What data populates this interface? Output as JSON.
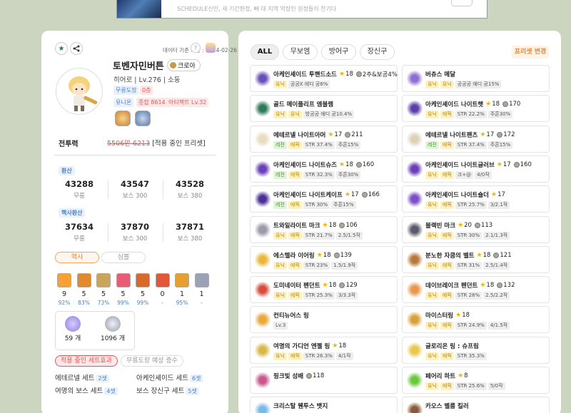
{
  "banner": {
    "text": "SCHEDULE신인, 새 기간한정, 빠 대 지역 악장인 원정들이 찬기다"
  },
  "profile": {
    "updated": "데이터 기준 시간 : 2024-02-26",
    "name": "토벤자민버튼",
    "world": "크로아",
    "job": "히어로 | Lv.276 | 소둥",
    "tags": {
      "murung": "무릉도장",
      "murung_floor": "0층",
      "union": "유니온",
      "union_val": "종합 8614",
      "artifact": "아티팩트 Lv.32"
    },
    "power_label": "전투력",
    "power_old": "5506만 6213",
    "power_note": "[적용 중인 프리셋]"
  },
  "stats": {
    "label1": "환산",
    "row1": [
      {
        "v": "43288",
        "l": "무릉"
      },
      {
        "v": "43547",
        "l": "보스 300"
      },
      {
        "v": "43528",
        "l": "보스 380"
      }
    ],
    "label2": "핵사환산",
    "row2": [
      {
        "v": "37634",
        "l": "무릉"
      },
      {
        "v": "37870",
        "l": "보스 300"
      },
      {
        "v": "37871",
        "l": "보스 380"
      }
    ]
  },
  "toggle": {
    "hexa": "핵사",
    "symbol": "심볼"
  },
  "symbols": [
    {
      "lv": "9",
      "pc": "92%",
      "c": "#f7a034"
    },
    {
      "lv": "5",
      "pc": "83%",
      "c": "#e0892d"
    },
    {
      "lv": "5",
      "pc": "73%",
      "c": "#c9a45a"
    },
    {
      "lv": "5",
      "pc": "99%",
      "c": "#e85d75"
    },
    {
      "lv": "5",
      "pc": "99%",
      "c": "#d86a2c"
    },
    {
      "lv": "0",
      "pc": "-",
      "c": "#e2573a"
    },
    {
      "lv": "1",
      "pc": "95%",
      "c": "#e5a030"
    },
    {
      "lv": "1",
      "pc": "-",
      "c": "#9aa3b5"
    }
  ],
  "symbol_totals": [
    {
      "t": "59 개",
      "c": "#8f7ee0"
    },
    {
      "t": "1096 개",
      "c": "#b7b9b0"
    }
  ],
  "sets": {
    "active_btn": "적용 중인 세트효과",
    "expected_btn": "무릉도장 예상 증수",
    "items": [
      {
        "name": "에테르넬 세트",
        "cnt": "2셋"
      },
      {
        "name": "아케인셰이드 세트",
        "cnt": "6셋"
      },
      {
        "name": "여명의 보스 세트",
        "cnt": "4셋"
      },
      {
        "name": "보스 장신구 세트",
        "cnt": "5셋"
      }
    ]
  },
  "tabs": [
    "ALL",
    "무보엠",
    "방어구",
    "장신구"
  ],
  "preset_btn": "프리셋 변경",
  "items": [
    {
      "name": "아케인셰이드 투핸드소드",
      "star": "18",
      "bl": "2추&보공4%",
      "tags": [
        [
          "유닉",
          "u"
        ],
        [
          "공공X 에디 공6%",
          "o"
        ]
      ],
      "c": "#6a4fb8"
    },
    {
      "name": "버츄스 메달",
      "star": "",
      "bl": "",
      "tags": [
        [
          "유닉",
          "u"
        ],
        [
          "유닉",
          "e"
        ],
        [
          "공공공 에디 공15%",
          "o"
        ]
      ],
      "c": "#8a6fd0"
    },
    {
      "name": "골드 메이플리프 엠블렘",
      "star": "",
      "bl": "",
      "tags": [
        [
          "유닉",
          "u"
        ],
        [
          "유닉",
          "e"
        ],
        [
          "방공공 에디 공10.4%",
          "o"
        ]
      ],
      "c": "#2e7a5a"
    },
    {
      "name": "아케인셰이드 나이트햇",
      "star": "18",
      "bl": "170",
      "tags": [
        [
          "유닉",
          "u"
        ],
        [
          "에픽",
          "e"
        ],
        [
          "STR 22.2%",
          "o"
        ],
        [
          "주흔30%",
          "o"
        ]
      ],
      "c": "#5a3fa8"
    },
    {
      "name": "에테르넬 나이트아머",
      "star": "17",
      "bl": "211",
      "tags": [
        [
          "레전",
          "l"
        ],
        [
          "에픽",
          "e"
        ],
        [
          "STR 37.4%",
          "o"
        ],
        [
          "주흔15%",
          "o"
        ]
      ],
      "c": "#e8dcc0"
    },
    {
      "name": "에테르넬 나이트팬츠",
      "star": "17",
      "bl": "172",
      "tags": [
        [
          "레전",
          "l"
        ],
        [
          "에픽",
          "e"
        ],
        [
          "STR 37.4%",
          "o"
        ],
        [
          "주흔15%",
          "o"
        ]
      ],
      "c": "#ddd2b8"
    },
    {
      "name": "아케인셰이드 나이트슈즈",
      "star": "18",
      "bl": "160",
      "tags": [
        [
          "레전",
          "l"
        ],
        [
          "에픽",
          "e"
        ],
        [
          "STR 32.3%",
          "o"
        ],
        [
          "주흔30%",
          "o"
        ]
      ],
      "c": "#6a3fb8"
    },
    {
      "name": "아케인셰이드 나이트글러브",
      "star": "17",
      "bl": "160",
      "tags": [
        [
          "유닉",
          "u"
        ],
        [
          "에픽",
          "e"
        ],
        [
          "크+@",
          "o"
        ],
        [
          "4/0작",
          "o"
        ]
      ],
      "c": "#6a3fb8"
    },
    {
      "name": "아케인셰이드 나이트케이프",
      "star": "17",
      "bl": "166",
      "tags": [
        [
          "레전",
          "l"
        ],
        [
          "에픽",
          "e"
        ],
        [
          "STR 30%",
          "o"
        ],
        [
          "주흔15%",
          "o"
        ]
      ],
      "c": "#4a2f98"
    },
    {
      "name": "아케인셰이드 나이트숄더",
      "star": "17",
      "bl": "",
      "tags": [
        [
          "유닉",
          "u"
        ],
        [
          "에픽",
          "e"
        ],
        [
          "STR 25.7%",
          "o"
        ],
        [
          "3/2.1작",
          "o"
        ]
      ],
      "c": "#7a4fc8"
    },
    {
      "name": "트와일라이트 마크",
      "star": "18",
      "bl": "106",
      "tags": [
        [
          "유닉",
          "u"
        ],
        [
          "에픽",
          "e"
        ],
        [
          "STR 21.7%",
          "o"
        ],
        [
          "2.5/1.5작",
          "o"
        ]
      ],
      "c": "#9a9aa8"
    },
    {
      "name": "블랙빈 마크",
      "star": "20",
      "bl": "113",
      "tags": [
        [
          "유닉",
          "u"
        ],
        [
          "에픽",
          "e"
        ],
        [
          "STR 30%",
          "o"
        ],
        [
          "2.1/1.3작",
          "o"
        ]
      ],
      "c": "#5a5a6a"
    },
    {
      "name": "에스텔라 이어링",
      "star": "18",
      "bl": "139",
      "tags": [
        [
          "유닉",
          "u"
        ],
        [
          "에픽",
          "e"
        ],
        [
          "STR 23%",
          "o"
        ],
        [
          "1.5/1.9작",
          "o"
        ]
      ],
      "c": "#e8b83a"
    },
    {
      "name": "분노한 자쿰의 벨트",
      "star": "18",
      "bl": "121",
      "tags": [
        [
          "유닉",
          "u"
        ],
        [
          "에픽",
          "e"
        ],
        [
          "STR 31%",
          "o"
        ],
        [
          "2.5/1.4작",
          "o"
        ]
      ],
      "c": "#b8783a"
    },
    {
      "name": "도미네이터 펜던트",
      "star": "18",
      "bl": "129",
      "tags": [
        [
          "유닉",
          "u"
        ],
        [
          "에픽",
          "e"
        ],
        [
          "STR 25.3%",
          "o"
        ],
        [
          "3/3.3작",
          "o"
        ]
      ],
      "c": "#d84a3a"
    },
    {
      "name": "데이브레이크 펜던트",
      "star": "18",
      "bl": "132",
      "tags": [
        [
          "유닉",
          "u"
        ],
        [
          "에픽",
          "e"
        ],
        [
          "STR 28%",
          "o"
        ],
        [
          "2.5/2.2작",
          "o"
        ]
      ],
      "c": "#e8984a"
    },
    {
      "name": "컨티뉴어스 링",
      "star": "",
      "bl": "",
      "tags": [
        [
          "Lv.3",
          "o"
        ]
      ],
      "c": "#e8a83a"
    },
    {
      "name": "마이스터링",
      "star": "18",
      "bl": "",
      "tags": [
        [
          "유닉",
          "u"
        ],
        [
          "에픽",
          "e"
        ],
        [
          "STR 24.9%",
          "o"
        ],
        [
          "4/1.5작",
          "o"
        ]
      ],
      "c": "#d8a03a"
    },
    {
      "name": "여명의 가디언 엔젤 링",
      "star": "18",
      "bl": "",
      "tags": [
        [
          "유닉",
          "u"
        ],
        [
          "에픽",
          "e"
        ],
        [
          "STR 26.3%",
          "o"
        ],
        [
          "4/1작",
          "o"
        ]
      ],
      "c": "#d8b84a"
    },
    {
      "name": "글로리온 링 : 슈프림",
      "star": "",
      "bl": "",
      "tags": [
        [
          "유닉",
          "u"
        ],
        [
          "에픽",
          "e"
        ],
        [
          "STR 35.3%",
          "o"
        ]
      ],
      "c": "#e8c84a"
    },
    {
      "name": "핑크빛 성배",
      "star": "",
      "bl": "118",
      "tags": [],
      "c": "#c8588a"
    },
    {
      "name": "페어리 하트",
      "star": "8",
      "bl": "",
      "tags": [
        [
          "유닉",
          "u"
        ],
        [
          "에픽",
          "e"
        ],
        [
          "STR 25.6%",
          "o"
        ],
        [
          "5/0작",
          "o"
        ]
      ],
      "c": "#6ac83a"
    },
    {
      "name": "크리스탈 웬투스 뱃지",
      "star": "",
      "bl": "",
      "tags": [],
      "c": "#7ab8e8"
    },
    {
      "name": "카오스 벨룸 킬러",
      "star": "",
      "bl": "",
      "tags": [],
      "c": "#8a5a3a"
    }
  ]
}
